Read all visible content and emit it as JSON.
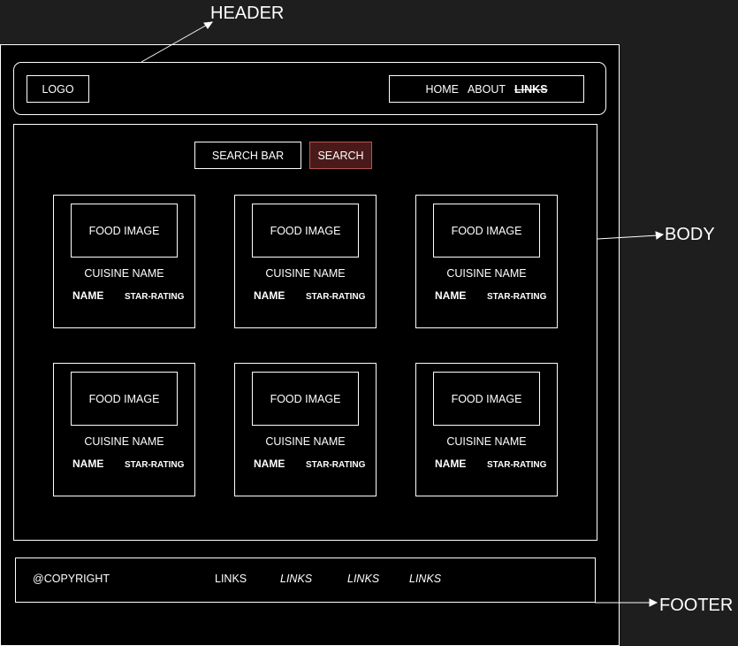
{
  "annotations": {
    "header": "HEADER",
    "body": "BODY",
    "footer": "FOOTER"
  },
  "header": {
    "logo": "LOGO",
    "nav": [
      "HOME",
      "ABOUT",
      "LINKS"
    ]
  },
  "search": {
    "bar_label": "SEARCH BAR",
    "button_label": "SEARCH"
  },
  "cards": [
    {
      "image": "FOOD IMAGE",
      "cuisine": "CUISINE NAME",
      "name": "NAME",
      "rating": "STAR-RATING"
    },
    {
      "image": "FOOD IMAGE",
      "cuisine": "CUISINE NAME",
      "name": "NAME",
      "rating": "STAR-RATING"
    },
    {
      "image": "FOOD IMAGE",
      "cuisine": "CUISINE NAME",
      "name": "NAME",
      "rating": "STAR-RATING"
    },
    {
      "image": "FOOD IMAGE",
      "cuisine": "CUISINE NAME",
      "name": "NAME",
      "rating": "STAR-RATING"
    },
    {
      "image": "FOOD IMAGE",
      "cuisine": "CUISINE NAME",
      "name": "NAME",
      "rating": "STAR-RATING"
    },
    {
      "image": "FOOD IMAGE",
      "cuisine": "CUISINE NAME",
      "name": "NAME",
      "rating": "STAR-RATING"
    }
  ],
  "footer": {
    "copyright": "@COPYRIGHT",
    "links": [
      "LINKS",
      "LINKS",
      "LINKS",
      "LINKS"
    ]
  },
  "colors": {
    "canvas": "#1e1e1e",
    "frame": "#000000",
    "stroke": "#ffffff",
    "search_button_fill": "#4a1a1a",
    "search_button_border": "#b85450"
  }
}
